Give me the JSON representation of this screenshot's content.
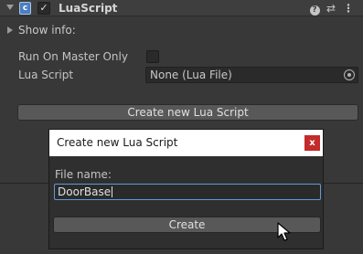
{
  "component": {
    "title": "LuaScript",
    "script_icon_glyph": "c",
    "enabled_glyph": "✓",
    "help_glyph": "?",
    "settings_glyph": "⇄",
    "menu_glyph": "⋮"
  },
  "foldout": {
    "label": "Show info:",
    "expanded": false
  },
  "properties": {
    "run_on_master_only": {
      "label": "Run On Master Only",
      "checked": false
    },
    "lua_script": {
      "label": "Lua Script",
      "value": "None (Lua File)"
    }
  },
  "create_button_label": "Create new Lua Script",
  "dialog": {
    "title": "Create new Lua Script",
    "close_glyph": "x",
    "file_name_label": "File name:",
    "file_name_value": "DoorBase",
    "create_label": "Create"
  },
  "colors": {
    "background": "#383838",
    "accent_focus": "#5f9ad8",
    "close_red": "#c42b2b",
    "script_blue": "#4a7fc0"
  },
  "icons": [
    "fold-arrow-icon",
    "script-icon",
    "checkbox-icon",
    "help-icon",
    "settings-icon",
    "menu-icon",
    "object-picker-icon",
    "close-icon",
    "mouse-cursor-icon"
  ]
}
